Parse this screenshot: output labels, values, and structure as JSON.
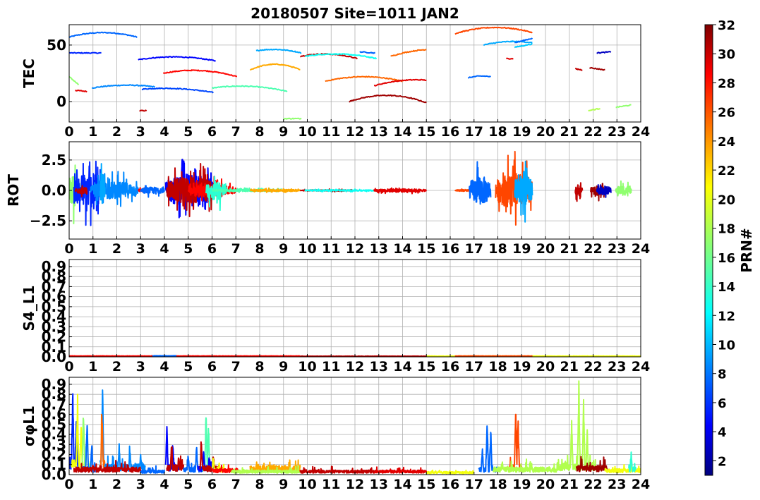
{
  "title": "20180507 Site=1011 JAN2",
  "colorbar": {
    "label": "PRN#",
    "vmin": 1,
    "vmax": 32,
    "ticks": [
      2,
      4,
      6,
      8,
      10,
      12,
      14,
      16,
      18,
      20,
      22,
      24,
      26,
      28,
      30,
      32
    ],
    "colormap": "jet"
  },
  "chart_data": [
    {
      "id": "tec",
      "type": "line",
      "ylabel": "TEC",
      "xlim": [
        0,
        24
      ],
      "ylim": [
        -18,
        68
      ],
      "xticks": [
        0,
        1,
        2,
        3,
        4,
        5,
        6,
        7,
        8,
        9,
        10,
        11,
        12,
        13,
        14,
        15,
        16,
        17,
        18,
        19,
        20,
        21,
        22,
        23,
        24
      ],
      "yticks": [
        0,
        50
      ],
      "grid": true,
      "segments": [
        {
          "prn": 8,
          "t0": 0.0,
          "t1": 2.85,
          "y0": 57,
          "y1": 57,
          "bow": 4
        },
        {
          "prn": 6,
          "t0": 0.0,
          "t1": 1.35,
          "y0": 43,
          "y1": 43,
          "bow": 0
        },
        {
          "prn": 17,
          "t0": 0.0,
          "t1": 0.4,
          "y0": 22,
          "y1": 15,
          "bow": 0
        },
        {
          "prn": 29,
          "t0": 0.25,
          "t1": 0.75,
          "y0": 10,
          "y1": 9,
          "bow": 0
        },
        {
          "prn": 9,
          "t0": 0.95,
          "t1": 3.6,
          "y0": 12,
          "y1": 13,
          "bow": 2
        },
        {
          "prn": 30,
          "t0": 2.95,
          "t1": 3.25,
          "y0": -8,
          "y1": -8,
          "bow": 0
        },
        {
          "prn": 5,
          "t0": 2.9,
          "t1": 6.15,
          "y0": 37,
          "y1": 36,
          "bow": 3
        },
        {
          "prn": 7,
          "t0": 3.05,
          "t1": 6.05,
          "y0": 11,
          "y1": 8,
          "bow": 2
        },
        {
          "prn": 28,
          "t0": 3.95,
          "t1": 7.05,
          "y0": 25,
          "y1": 22,
          "bow": 4
        },
        {
          "prn": 15,
          "t0": 6.0,
          "t1": 9.15,
          "y0": 12,
          "y1": 9,
          "bow": 3
        },
        {
          "prn": 23,
          "t0": 7.6,
          "t1": 9.7,
          "y0": 28,
          "y1": 28,
          "bow": 5
        },
        {
          "prn": 10,
          "t0": 7.85,
          "t1": 9.75,
          "y0": 45,
          "y1": 43,
          "bow": 2
        },
        {
          "prn": 17,
          "t0": 9.0,
          "t1": 9.75,
          "y0": -15,
          "y1": -15,
          "bow": 0
        },
        {
          "prn": 30,
          "t0": 9.7,
          "t1": 12.1,
          "y0": 40,
          "y1": 38,
          "bow": 3
        },
        {
          "prn": 13,
          "t0": 9.9,
          "t1": 12.9,
          "y0": 40,
          "y1": 38,
          "bow": 3
        },
        {
          "prn": 25,
          "t0": 10.75,
          "t1": 14.0,
          "y0": 18,
          "y1": 18,
          "bow": 4
        },
        {
          "prn": 31,
          "t0": 11.75,
          "t1": 15.0,
          "y0": 0,
          "y1": -1,
          "bow": 6
        },
        {
          "prn": 8,
          "t0": 12.2,
          "t1": 12.85,
          "y0": 44,
          "y1": 43,
          "bow": 0
        },
        {
          "prn": 29,
          "t0": 12.8,
          "t1": 15.0,
          "y0": 14,
          "y1": 19,
          "bow": 2
        },
        {
          "prn": 25,
          "t0": 13.5,
          "t1": 15.0,
          "y0": 40,
          "y1": 46,
          "bow": 1
        },
        {
          "prn": 26,
          "t0": 16.2,
          "t1": 19.45,
          "y0": 60,
          "y1": 61,
          "bow": 5
        },
        {
          "prn": 10,
          "t0": 17.4,
          "t1": 19.45,
          "y0": 50,
          "y1": 52,
          "bow": 2
        },
        {
          "prn": 8,
          "t0": 16.75,
          "t1": 17.7,
          "y0": 21,
          "y1": 22,
          "bow": 1
        },
        {
          "prn": 29,
          "t0": 18.35,
          "t1": 18.65,
          "y0": 38,
          "y1": 38,
          "bow": 0
        },
        {
          "prn": 8,
          "t0": 18.7,
          "t1": 19.45,
          "y0": 52,
          "y1": 56,
          "bow": 0
        },
        {
          "prn": 11,
          "t0": 18.7,
          "t1": 19.45,
          "y0": 48,
          "y1": 51,
          "bow": 0
        },
        {
          "prn": 30,
          "t0": 21.25,
          "t1": 21.55,
          "y0": 29,
          "y1": 28,
          "bow": 0
        },
        {
          "prn": 31,
          "t0": 21.85,
          "t1": 22.5,
          "y0": 30,
          "y1": 28,
          "bow": 0
        },
        {
          "prn": 18,
          "t0": 21.8,
          "t1": 22.3,
          "y0": -8,
          "y1": -6,
          "bow": 0
        },
        {
          "prn": 3,
          "t0": 22.15,
          "t1": 22.75,
          "y0": 43,
          "y1": 44,
          "bow": 0
        },
        {
          "prn": 17,
          "t0": 22.95,
          "t1": 23.6,
          "y0": -5,
          "y1": -3,
          "bow": 0
        }
      ]
    },
    {
      "id": "rot",
      "type": "line",
      "ylabel": "ROT",
      "xlim": [
        0,
        24
      ],
      "ylim": [
        -4,
        4
      ],
      "xticks": [
        0,
        1,
        2,
        3,
        4,
        5,
        6,
        7,
        8,
        9,
        10,
        11,
        12,
        13,
        14,
        15,
        16,
        17,
        18,
        19,
        20,
        21,
        22,
        23,
        24
      ],
      "yticks": [
        -2.5,
        0.0,
        2.5
      ],
      "grid": true,
      "segments": [
        {
          "prn": 17,
          "t0": 0.0,
          "t1": 0.45,
          "amp": 2.8
        },
        {
          "prn": 6,
          "t0": 0.2,
          "t1": 1.35,
          "amp": 3.2
        },
        {
          "prn": 30,
          "t0": 0.25,
          "t1": 0.75,
          "amp": 0.6
        },
        {
          "prn": 9,
          "t0": 0.9,
          "t1": 2.9,
          "amp": 1.6
        },
        {
          "prn": 10,
          "t0": 1.3,
          "t1": 1.5,
          "amp": 3.0
        },
        {
          "prn": 28,
          "t0": 2.9,
          "t1": 3.3,
          "amp": 0.3
        },
        {
          "prn": 8,
          "t0": 3.0,
          "t1": 4.0,
          "amp": 0.6
        },
        {
          "prn": 5,
          "t0": 4.05,
          "t1": 6.1,
          "amp": 3.0
        },
        {
          "prn": 30,
          "t0": 4.1,
          "t1": 6.2,
          "amp": 2.4
        },
        {
          "prn": 28,
          "t0": 5.0,
          "t1": 7.0,
          "amp": 1.0
        },
        {
          "prn": 14,
          "t0": 5.75,
          "t1": 6.6,
          "amp": 1.8
        },
        {
          "prn": 15,
          "t0": 6.0,
          "t1": 9.2,
          "amp": 0.2
        },
        {
          "prn": 23,
          "t0": 7.6,
          "t1": 9.7,
          "amp": 0.2
        },
        {
          "prn": 30,
          "t0": 9.7,
          "t1": 12.1,
          "amp": 0.12
        },
        {
          "prn": 13,
          "t0": 9.9,
          "t1": 12.9,
          "amp": 0.12
        },
        {
          "prn": 29,
          "t0": 12.8,
          "t1": 15.0,
          "amp": 0.3
        },
        {
          "prn": 26,
          "t0": 16.2,
          "t1": 17.5,
          "amp": 0.2
        },
        {
          "prn": 8,
          "t0": 16.8,
          "t1": 17.7,
          "amp": 2.6
        },
        {
          "prn": 26,
          "t0": 17.9,
          "t1": 19.45,
          "amp": 3.2
        },
        {
          "prn": 10,
          "t0": 18.7,
          "t1": 19.45,
          "amp": 2.8
        },
        {
          "prn": 30,
          "t0": 21.25,
          "t1": 21.55,
          "amp": 1.0
        },
        {
          "prn": 31,
          "t0": 21.9,
          "t1": 22.5,
          "amp": 0.9
        },
        {
          "prn": 3,
          "t0": 22.15,
          "t1": 22.75,
          "amp": 0.8
        },
        {
          "prn": 17,
          "t0": 22.95,
          "t1": 23.6,
          "amp": 0.9
        }
      ]
    },
    {
      "id": "s4",
      "type": "line",
      "ylabel": "S4_L1",
      "xlim": [
        0,
        24
      ],
      "ylim": [
        0,
        0.97
      ],
      "xticks": [
        0,
        1,
        2,
        3,
        4,
        5,
        6,
        7,
        8,
        9,
        10,
        11,
        12,
        13,
        14,
        15,
        16,
        17,
        18,
        19,
        20,
        21,
        22,
        23,
        24
      ],
      "yticks": [
        0.0,
        0.1,
        0.2,
        0.3,
        0.4,
        0.5,
        0.6,
        0.7,
        0.8,
        0.9
      ],
      "grid": true,
      "segments": [
        {
          "prn": 28,
          "t0": 0.0,
          "t1": 9.7,
          "level": 0.008
        },
        {
          "prn": 8,
          "t0": 3.5,
          "t1": 4.5,
          "level": 0.01
        },
        {
          "prn": 30,
          "t0": 9.7,
          "t1": 15.0,
          "level": 0.006
        },
        {
          "prn": 20,
          "t0": 15.0,
          "t1": 24.0,
          "level": 0.007
        },
        {
          "prn": 26,
          "t0": 16.2,
          "t1": 19.45,
          "level": 0.008
        }
      ]
    },
    {
      "id": "sigma",
      "type": "line",
      "ylabel": "σφL1",
      "xlim": [
        0,
        24
      ],
      "ylim": [
        0,
        0.97
      ],
      "xticks": [
        0,
        1,
        2,
        3,
        4,
        5,
        6,
        7,
        8,
        9,
        10,
        11,
        12,
        13,
        14,
        15,
        16,
        17,
        18,
        19,
        20,
        21,
        22,
        23,
        24
      ],
      "yticks": [
        0.0,
        0.1,
        0.2,
        0.3,
        0.4,
        0.5,
        0.6,
        0.7,
        0.8,
        0.9
      ],
      "grid": true,
      "segments": [
        {
          "prn": 6,
          "t0": 0.0,
          "t1": 0.4,
          "base": 0.1,
          "peaks": [
            [
              0.15,
              0.93
            ],
            [
              0.3,
              0.6
            ]
          ]
        },
        {
          "prn": 20,
          "t0": 0.1,
          "t1": 0.6,
          "base": 0.1,
          "peaks": [
            [
              0.35,
              0.76
            ],
            [
              0.5,
              0.62
            ]
          ]
        },
        {
          "prn": 17,
          "t0": 0.5,
          "t1": 0.9,
          "base": 0.08,
          "peaks": [
            [
              0.6,
              0.72
            ],
            [
              0.75,
              0.5
            ]
          ]
        },
        {
          "prn": 8,
          "t0": 0.5,
          "t1": 1.1,
          "base": 0.05,
          "peaks": [
            [
              0.75,
              0.6
            ],
            [
              0.95,
              0.35
            ]
          ]
        },
        {
          "prn": 9,
          "t0": 1.3,
          "t1": 1.5,
          "base": 0.1,
          "peaks": [
            [
              1.4,
              0.97
            ]
          ]
        },
        {
          "prn": 25,
          "t0": 1.3,
          "t1": 1.5,
          "base": 0.1,
          "peaks": [
            [
              1.38,
              0.66
            ]
          ]
        },
        {
          "prn": 9,
          "t0": 1.5,
          "t1": 3.2,
          "base": 0.07,
          "peaks": [
            [
              2.1,
              0.33
            ],
            [
              2.55,
              0.28
            ],
            [
              3.0,
              0.22
            ]
          ]
        },
        {
          "prn": 30,
          "t0": 0.2,
          "t1": 3.0,
          "base": 0.05,
          "peaks": [
            [
              1.0,
              0.12
            ],
            [
              2.2,
              0.1
            ]
          ]
        },
        {
          "prn": 8,
          "t0": 3.0,
          "t1": 4.0,
          "base": 0.03,
          "peaks": [
            [
              3.5,
              0.08
            ]
          ]
        },
        {
          "prn": 5,
          "t0": 4.05,
          "t1": 4.6,
          "base": 0.07,
          "peaks": [
            [
              4.1,
              0.52
            ],
            [
              4.35,
              0.33
            ]
          ]
        },
        {
          "prn": 30,
          "t0": 4.1,
          "t1": 4.8,
          "base": 0.07,
          "peaks": [
            [
              4.3,
              0.32
            ],
            [
              4.6,
              0.2
            ]
          ]
        },
        {
          "prn": 8,
          "t0": 4.8,
          "t1": 5.6,
          "base": 0.05,
          "peaks": [
            [
              5.0,
              0.2
            ],
            [
              5.35,
              0.3
            ]
          ]
        },
        {
          "prn": 15,
          "t0": 5.6,
          "t1": 6.0,
          "base": 0.06,
          "peaks": [
            [
              5.75,
              0.68
            ],
            [
              5.85,
              0.55
            ]
          ]
        },
        {
          "prn": 5,
          "t0": 5.4,
          "t1": 6.1,
          "base": 0.06,
          "peaks": [
            [
              5.65,
              0.25
            ],
            [
              5.9,
              0.18
            ]
          ]
        },
        {
          "prn": 30,
          "t0": 5.5,
          "t1": 6.3,
          "base": 0.06,
          "peaks": [
            [
              5.55,
              0.34
            ],
            [
              6.05,
              0.24
            ]
          ]
        },
        {
          "prn": 20,
          "t0": 6.0,
          "t1": 6.5,
          "base": 0.05,
          "peaks": [
            [
              6.05,
              0.2
            ],
            [
              6.3,
              0.12
            ]
          ]
        },
        {
          "prn": 28,
          "t0": 6.0,
          "t1": 7.1,
          "base": 0.04,
          "peaks": [
            [
              6.4,
              0.08
            ]
          ]
        },
        {
          "prn": 23,
          "t0": 7.6,
          "t1": 9.7,
          "base": 0.06,
          "peaks": [
            [
              8.2,
              0.09
            ],
            [
              9.0,
              0.08
            ]
          ]
        },
        {
          "prn": 18,
          "t0": 6.8,
          "t1": 9.7,
          "base": 0.03,
          "peaks": []
        },
        {
          "prn": 30,
          "t0": 9.7,
          "t1": 12.9,
          "base": 0.03,
          "peaks": []
        },
        {
          "prn": 29,
          "t0": 12.8,
          "t1": 15.0,
          "base": 0.03,
          "peaks": [
            [
              14.0,
              0.06
            ]
          ]
        },
        {
          "prn": 20,
          "t0": 15.0,
          "t1": 17.0,
          "base": 0.02,
          "peaks": []
        },
        {
          "prn": 8,
          "t0": 17.2,
          "t1": 18.0,
          "base": 0.05,
          "peaks": [
            [
              17.55,
              0.58
            ],
            [
              17.7,
              0.48
            ],
            [
              17.35,
              0.3
            ]
          ]
        },
        {
          "prn": 26,
          "t0": 18.5,
          "t1": 19.0,
          "base": 0.07,
          "peaks": [
            [
              18.75,
              0.72
            ],
            [
              18.85,
              0.6
            ]
          ]
        },
        {
          "prn": 18,
          "t0": 17.8,
          "t1": 20.5,
          "base": 0.05,
          "peaks": [
            [
              18.2,
              0.1
            ],
            [
              19.2,
              0.09
            ]
          ]
        },
        {
          "prn": 18,
          "t0": 20.5,
          "t1": 22.1,
          "base": 0.08,
          "peaks": [
            [
              21.1,
              0.6
            ],
            [
              21.4,
              0.93
            ],
            [
              21.6,
              0.8
            ],
            [
              21.75,
              0.5
            ]
          ]
        },
        {
          "prn": 31,
          "t0": 21.3,
          "t1": 22.6,
          "base": 0.06,
          "peaks": [
            [
              21.5,
              0.12
            ],
            [
              22.3,
              0.1
            ]
          ]
        },
        {
          "prn": 20,
          "t0": 22.5,
          "t1": 24.0,
          "base": 0.04,
          "peaks": [
            [
              23.3,
              0.1
            ],
            [
              23.6,
              0.08
            ]
          ]
        },
        {
          "prn": 14,
          "t0": 23.5,
          "t1": 23.8,
          "base": 0.05,
          "peaks": [
            [
              23.6,
              0.24
            ]
          ]
        }
      ]
    }
  ]
}
